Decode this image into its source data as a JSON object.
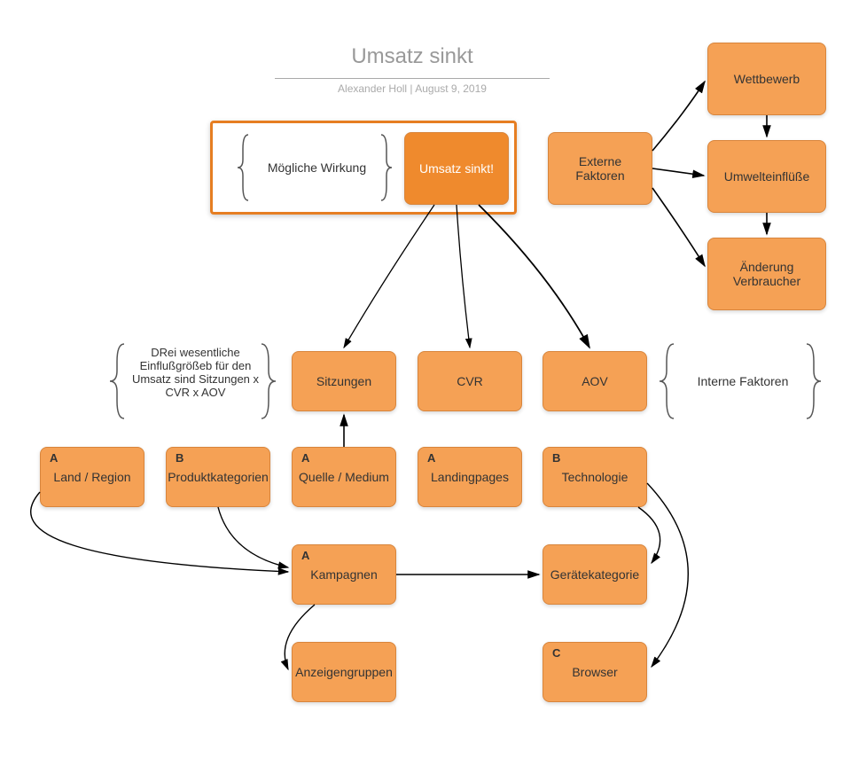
{
  "header": {
    "title": "Umsatz sinkt",
    "author": "Alexander Holl",
    "date": "August 9, 2019"
  },
  "braces": {
    "effect": "Mögliche Wirkung",
    "formula": "DRei wesentliche Einflußgrößeb für den Umsatz sind Sitzungen  x CVR x AOV",
    "internal": "Interne Faktoren"
  },
  "nodes": {
    "umsatz": "Umsatz sinkt!",
    "externe": "Externe Faktoren",
    "wettbewerb": "Wettbewerb",
    "umwelt": "Umwelteinflüße",
    "verbraucher": "Änderung Verbraucher",
    "sitzungen": "Sitzungen",
    "cvr": "CVR",
    "aov": "AOV",
    "land": "Land / Region",
    "produkt": "Produktkategorien",
    "quelle": "Quelle / Medium",
    "landing": "Landingpages",
    "technologie": "Technologie",
    "kampagnen": "Kampagnen",
    "geraete": "Gerätekategorie",
    "anzeigen": "Anzeigengruppen",
    "browser": "Browser"
  },
  "labels": {
    "a": "A",
    "b": "B",
    "c": "C"
  }
}
